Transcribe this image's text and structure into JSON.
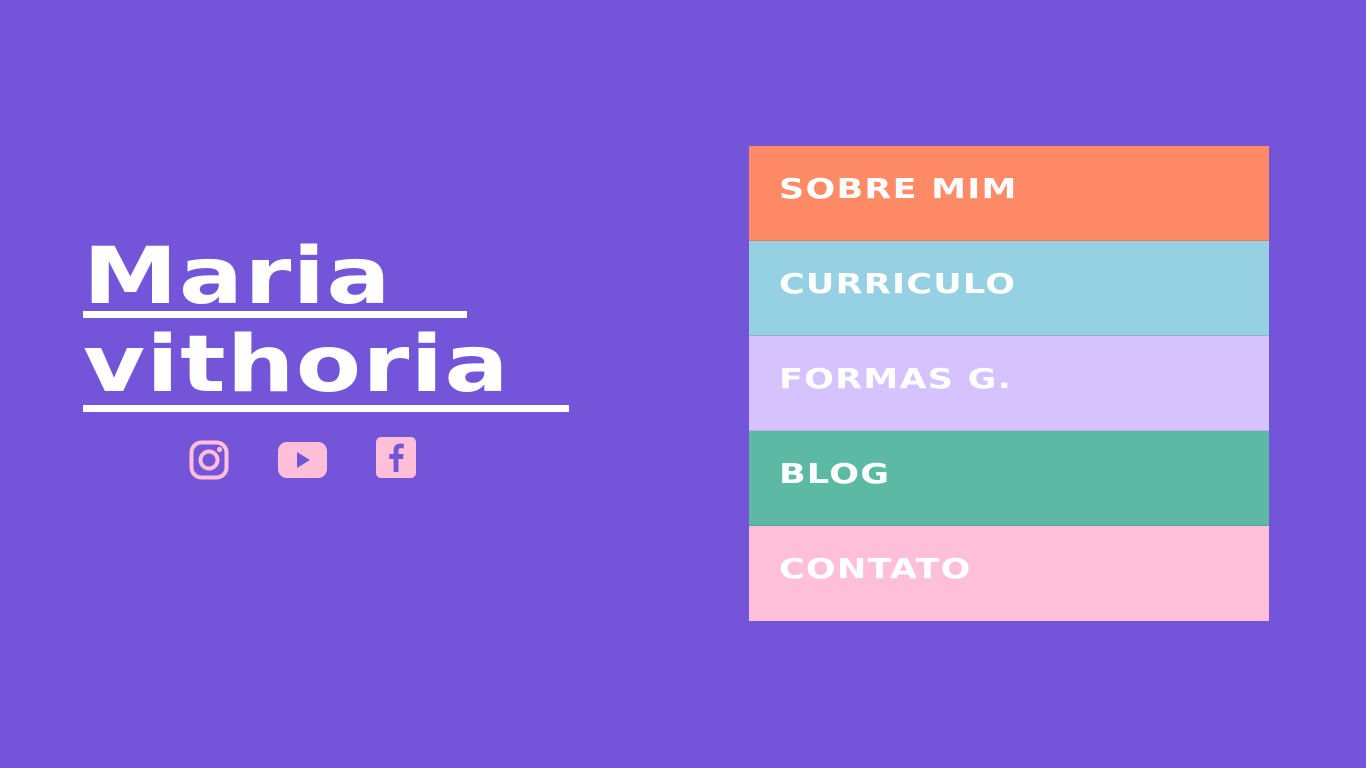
{
  "colors": {
    "background": "#7455d9",
    "text": "#ffffff",
    "icon": "#ffbfd8",
    "menu_sobre": "#ff8a65",
    "menu_curriculo": "#96d0e3",
    "menu_formas": "#d6c2ff",
    "menu_blog": "#5cbaa4",
    "menu_contato": "#ffbfd8"
  },
  "profile": {
    "first_name": "Maria",
    "last_name": "vithoria"
  },
  "social": [
    {
      "icon": "instagram-icon"
    },
    {
      "icon": "youtube-icon"
    },
    {
      "icon": "facebook-icon"
    }
  ],
  "menu": {
    "items": [
      {
        "label": "SOBRE MIM",
        "color": "#ff8a65"
      },
      {
        "label": "CURRICULO",
        "color": "#96d0e3"
      },
      {
        "label": "FORMAS G.",
        "color": "#d6c2ff"
      },
      {
        "label": "BLOG",
        "color": "#5cbaa4"
      },
      {
        "label": "CONTATO",
        "color": "#ffbfd8"
      }
    ]
  }
}
